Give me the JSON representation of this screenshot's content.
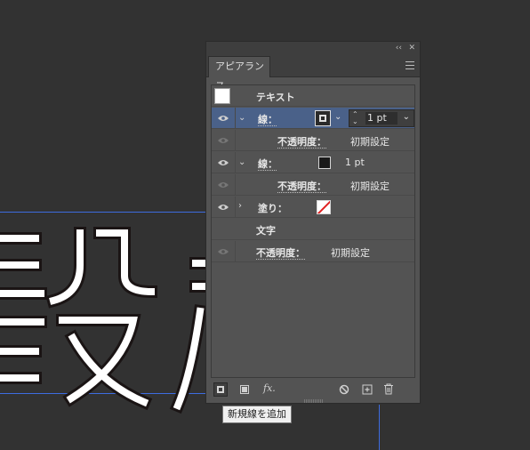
{
  "canvas": {
    "art_text": "設"
  },
  "panel": {
    "title": "アピアランス",
    "controls": {
      "collapse": "‹‹",
      "close": "✕"
    },
    "rows": [
      {
        "label": "テキスト"
      },
      {
        "label": "線：",
        "stroke_value": "1 pt"
      },
      {
        "label": "不透明度：",
        "value": "初期設定"
      },
      {
        "label": "線：",
        "stroke_value": "1 pt"
      },
      {
        "label": "不透明度：",
        "value": "初期設定"
      },
      {
        "label": "塗り："
      },
      {
        "label": "文字"
      },
      {
        "label": "不透明度：",
        "value": "初期設定"
      }
    ],
    "bottom": {
      "fx": "fx."
    }
  },
  "tooltip": {
    "text": "新規線を追加"
  }
}
